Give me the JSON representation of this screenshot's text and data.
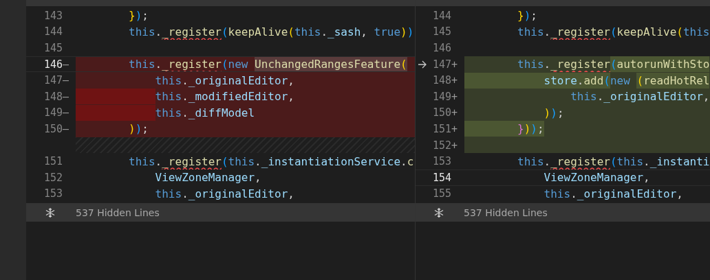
{
  "panes": [
    {
      "lines": [
        {
          "number": "143",
          "kind": "normal",
          "active": false,
          "revert_arrow": false,
          "indent_highlight": false,
          "tokens": [
            {
              "text": "        }",
              "kind": "b1",
              "highlight": false,
              "squiggle": false
            },
            {
              "text": ")",
              "kind": "b3",
              "highlight": false,
              "squiggle": false
            },
            {
              "text": ";",
              "kind": "p",
              "highlight": false,
              "squiggle": false
            }
          ]
        },
        {
          "number": "144",
          "kind": "normal",
          "active": false,
          "revert_arrow": false,
          "indent_highlight": false,
          "tokens": [
            {
              "text": "        this",
              "kind": "kw",
              "highlight": false,
              "squiggle": false
            },
            {
              "text": ".",
              "kind": "p",
              "highlight": false,
              "squiggle": false
            },
            {
              "text": "_register",
              "kind": "fn",
              "highlight": false,
              "squiggle": true
            },
            {
              "text": "(",
              "kind": "b3",
              "highlight": false,
              "squiggle": false
            },
            {
              "text": "keepAlive",
              "kind": "fn",
              "highlight": false,
              "squiggle": false
            },
            {
              "text": "(",
              "kind": "b1",
              "highlight": false,
              "squiggle": false
            },
            {
              "text": "this",
              "kind": "kw",
              "highlight": false,
              "squiggle": false
            },
            {
              "text": ".",
              "kind": "p",
              "highlight": false,
              "squiggle": false
            },
            {
              "text": "_sash",
              "kind": "var",
              "highlight": false,
              "squiggle": false
            },
            {
              "text": ", ",
              "kind": "p",
              "highlight": false,
              "squiggle": false
            },
            {
              "text": "true",
              "kind": "kw",
              "highlight": false,
              "squiggle": false
            },
            {
              "text": ")",
              "kind": "b1",
              "highlight": false,
              "squiggle": false
            },
            {
              "text": ")",
              "kind": "b3",
              "highlight": false,
              "squiggle": false
            }
          ]
        },
        {
          "number": "145",
          "kind": "normal",
          "active": false,
          "revert_arrow": false
        },
        {
          "number": "146",
          "sign": "—",
          "kind": "removed",
          "active": true,
          "revert_arrow": false,
          "indent_highlight": false,
          "tokens": [
            {
              "text": "        this",
              "kind": "kw",
              "highlight": false,
              "squiggle": false
            },
            {
              "text": ".",
              "kind": "p",
              "highlight": false,
              "squiggle": false
            },
            {
              "text": "_register",
              "kind": "fn",
              "highlight": false,
              "squiggle": true
            },
            {
              "text": "(",
              "kind": "b3",
              "highlight": false,
              "squiggle": false
            },
            {
              "text": "new ",
              "kind": "kw",
              "highlight": false,
              "squiggle": false
            },
            {
              "text": "UnchangedRangesFeature",
              "kind": "fn",
              "highlight": true,
              "squiggle": false
            },
            {
              "text": "(",
              "kind": "b1",
              "highlight": true,
              "squiggle": false
            }
          ]
        },
        {
          "number": "147",
          "sign": "—",
          "kind": "removed",
          "active": false,
          "revert_arrow": false,
          "indent_highlight": false,
          "tokens": [
            {
              "text": "            this",
              "kind": "kw",
              "highlight": false,
              "squiggle": false
            },
            {
              "text": ".",
              "kind": "p",
              "highlight": false,
              "squiggle": false
            },
            {
              "text": "_originalEditor",
              "kind": "var",
              "highlight": false,
              "squiggle": false
            },
            {
              "text": ",",
              "kind": "p",
              "highlight": false,
              "squiggle": false
            }
          ]
        },
        {
          "number": "148",
          "sign": "—",
          "kind": "removed",
          "active": false,
          "revert_arrow": false,
          "indent_highlight": true,
          "tokens": [
            {
              "text": "            this",
              "kind": "kw",
              "highlight": false,
              "squiggle": false
            },
            {
              "text": ".",
              "kind": "p",
              "highlight": false,
              "squiggle": false
            },
            {
              "text": "_modifiedEditor",
              "kind": "var",
              "highlight": false,
              "squiggle": false
            },
            {
              "text": ",",
              "kind": "p",
              "highlight": false,
              "squiggle": false
            }
          ]
        },
        {
          "number": "149",
          "sign": "—",
          "kind": "removed",
          "active": false,
          "revert_arrow": false,
          "indent_highlight": true,
          "tokens": [
            {
              "text": "            this",
              "kind": "kw",
              "highlight": false,
              "squiggle": false
            },
            {
              "text": ".",
              "kind": "p",
              "highlight": false,
              "squiggle": false
            },
            {
              "text": "_diffModel",
              "kind": "var",
              "highlight": false,
              "squiggle": false
            }
          ]
        },
        {
          "number": "150",
          "sign": "—",
          "kind": "removed",
          "active": false,
          "revert_arrow": false,
          "indent_highlight": false,
          "tokens": [
            {
              "text": "        )",
              "kind": "b1",
              "highlight": false,
              "squiggle": false
            },
            {
              "text": ")",
              "kind": "b3",
              "highlight": false,
              "squiggle": false
            },
            {
              "text": ";",
              "kind": "p",
              "highlight": false,
              "squiggle": false
            }
          ]
        },
        {
          "kind": "filler",
          "active": false,
          "revert_arrow": false
        },
        {
          "number": "151",
          "kind": "normal",
          "active": false,
          "revert_arrow": false,
          "indent_highlight": false,
          "tokens": [
            {
              "text": "        this",
              "kind": "kw",
              "highlight": false,
              "squiggle": false
            },
            {
              "text": ".",
              "kind": "p",
              "highlight": false,
              "squiggle": false
            },
            {
              "text": "_register",
              "kind": "fn",
              "highlight": false,
              "squiggle": true
            },
            {
              "text": "(",
              "kind": "b3",
              "highlight": false,
              "squiggle": false
            },
            {
              "text": "this",
              "kind": "kw",
              "highlight": false,
              "squiggle": false
            },
            {
              "text": ".",
              "kind": "p",
              "highlight": false,
              "squiggle": false
            },
            {
              "text": "_instantiationService",
              "kind": "var",
              "highlight": false,
              "squiggle": false
            },
            {
              "text": ".",
              "kind": "p",
              "highlight": false,
              "squiggle": false
            },
            {
              "text": "c",
              "kind": "fn",
              "highlight": false,
              "squiggle": false
            }
          ]
        },
        {
          "number": "152",
          "kind": "normal",
          "active": false,
          "revert_arrow": false,
          "indent_highlight": false,
          "tokens": [
            {
              "text": "            ViewZoneManager",
              "kind": "var",
              "highlight": false,
              "squiggle": false
            },
            {
              "text": ",",
              "kind": "p",
              "highlight": false,
              "squiggle": false
            }
          ]
        },
        {
          "number": "153",
          "kind": "normal",
          "active": false,
          "revert_arrow": false,
          "indent_highlight": false,
          "tokens": [
            {
              "text": "            this",
              "kind": "kw",
              "highlight": false,
              "squiggle": false
            },
            {
              "text": ".",
              "kind": "p",
              "highlight": false,
              "squiggle": false
            },
            {
              "text": "_originalEditor",
              "kind": "var",
              "highlight": false,
              "squiggle": false
            },
            {
              "text": ",",
              "kind": "p",
              "highlight": false,
              "squiggle": false
            }
          ]
        }
      ],
      "hidden_lines": "537 Hidden Lines"
    },
    {
      "lines": [
        {
          "number": "144",
          "kind": "normal",
          "active": false,
          "revert_arrow": false,
          "indent_highlight": false,
          "tokens": [
            {
              "text": "        }",
              "kind": "b1",
              "highlight": false,
              "squiggle": false
            },
            {
              "text": ")",
              "kind": "b3",
              "highlight": false,
              "squiggle": false
            },
            {
              "text": ";",
              "kind": "p",
              "highlight": false,
              "squiggle": false
            }
          ]
        },
        {
          "number": "145",
          "kind": "normal",
          "active": false,
          "revert_arrow": false,
          "indent_highlight": false,
          "tokens": [
            {
              "text": "        this",
              "kind": "kw",
              "highlight": false,
              "squiggle": false
            },
            {
              "text": ".",
              "kind": "p",
              "highlight": false,
              "squiggle": false
            },
            {
              "text": "_register",
              "kind": "fn",
              "highlight": false,
              "squiggle": true
            },
            {
              "text": "(",
              "kind": "b3",
              "highlight": false,
              "squiggle": false
            },
            {
              "text": "keepAlive",
              "kind": "fn",
              "highlight": false,
              "squiggle": false
            },
            {
              "text": "(",
              "kind": "b1",
              "highlight": false,
              "squiggle": false
            },
            {
              "text": "this",
              "kind": "kw",
              "highlight": false,
              "squiggle": false
            }
          ]
        },
        {
          "number": "146",
          "kind": "normal",
          "active": false,
          "revert_arrow": false
        },
        {
          "number": "147",
          "sign": "+",
          "kind": "added",
          "active": false,
          "revert_arrow": true,
          "indent_highlight": false,
          "tokens": [
            {
              "text": "        this",
              "kind": "kw",
              "highlight": false,
              "squiggle": false
            },
            {
              "text": ".",
              "kind": "p",
              "highlight": false,
              "squiggle": false
            },
            {
              "text": "_register",
              "kind": "fn",
              "highlight": false,
              "squiggle": true
            },
            {
              "text": "(",
              "kind": "b3",
              "highlight": true,
              "squiggle": false
            },
            {
              "text": "autorunWithSto",
              "kind": "fn",
              "highlight": true,
              "squiggle": false
            }
          ]
        },
        {
          "number": "148",
          "sign": "+",
          "kind": "added",
          "active": false,
          "revert_arrow": false,
          "indent_highlight": true,
          "tokens": [
            {
              "text": "            store",
              "kind": "var",
              "highlight": true,
              "squiggle": false
            },
            {
              "text": ".",
              "kind": "p",
              "highlight": true,
              "squiggle": false
            },
            {
              "text": "add",
              "kind": "fn",
              "highlight": true,
              "squiggle": false
            },
            {
              "text": "(",
              "kind": "b3",
              "highlight": true,
              "squiggle": false
            },
            {
              "text": "new ",
              "kind": "kw",
              "highlight": false,
              "squiggle": false
            },
            {
              "text": "(",
              "kind": "b1",
              "highlight": true,
              "squiggle": false
            },
            {
              "text": "readHotRel",
              "kind": "fn",
              "highlight": true,
              "squiggle": false
            }
          ]
        },
        {
          "number": "149",
          "sign": "+",
          "kind": "added",
          "active": false,
          "revert_arrow": false,
          "indent_highlight": false,
          "tokens": [
            {
              "text": "                this",
              "kind": "kw",
              "highlight": false,
              "squiggle": false
            },
            {
              "text": ".",
              "kind": "p",
              "highlight": false,
              "squiggle": false
            },
            {
              "text": "_originalEditor",
              "kind": "var",
              "highlight": false,
              "squiggle": false
            },
            {
              "text": ",",
              "kind": "p",
              "highlight": false,
              "squiggle": false
            }
          ]
        },
        {
          "number": "150",
          "sign": "+",
          "kind": "added",
          "active": false,
          "revert_arrow": false,
          "indent_highlight": false,
          "tokens": [
            {
              "text": "            )",
              "kind": "b1",
              "highlight": false,
              "squiggle": false
            },
            {
              "text": ")",
              "kind": "b3",
              "highlight": false,
              "squiggle": false
            },
            {
              "text": ";",
              "kind": "p",
              "highlight": false,
              "squiggle": false
            }
          ]
        },
        {
          "number": "151",
          "sign": "+",
          "kind": "added",
          "active": false,
          "revert_arrow": false,
          "indent_highlight": true,
          "tokens": [
            {
              "text": "        }",
              "kind": "b2",
              "highlight": true,
              "squiggle": false
            },
            {
              "text": ")",
              "kind": "b1",
              "highlight": true,
              "squiggle": false
            },
            {
              "text": ")",
              "kind": "b3",
              "highlight": true,
              "squiggle": false
            },
            {
              "text": ";",
              "kind": "p",
              "highlight": true,
              "squiggle": false
            }
          ]
        },
        {
          "number": "152",
          "sign": "+",
          "kind": "added",
          "active": false,
          "revert_arrow": false
        },
        {
          "number": "153",
          "kind": "normal",
          "active": false,
          "revert_arrow": false,
          "indent_highlight": false,
          "tokens": [
            {
              "text": "        this",
              "kind": "kw",
              "highlight": false,
              "squiggle": false
            },
            {
              "text": ".",
              "kind": "p",
              "highlight": false,
              "squiggle": false
            },
            {
              "text": "_register",
              "kind": "fn",
              "highlight": false,
              "squiggle": true
            },
            {
              "text": "(",
              "kind": "b3",
              "highlight": false,
              "squiggle": false
            },
            {
              "text": "this",
              "kind": "kw",
              "highlight": false,
              "squiggle": false
            },
            {
              "text": ".",
              "kind": "p",
              "highlight": false,
              "squiggle": false
            },
            {
              "text": "_instanti",
              "kind": "var",
              "highlight": false,
              "squiggle": false
            }
          ]
        },
        {
          "number": "154",
          "kind": "normal",
          "active": true,
          "revert_arrow": false,
          "indent_highlight": false,
          "tokens": [
            {
              "text": "            ViewZoneManager",
              "kind": "var",
              "highlight": false,
              "squiggle": false
            },
            {
              "text": ",",
              "kind": "p",
              "highlight": false,
              "squiggle": false
            }
          ]
        },
        {
          "number": "155",
          "kind": "normal",
          "active": false,
          "revert_arrow": false,
          "indent_highlight": false,
          "tokens": [
            {
              "text": "            this",
              "kind": "kw",
              "highlight": false,
              "squiggle": false
            },
            {
              "text": ".",
              "kind": "p",
              "highlight": false,
              "squiggle": false
            },
            {
              "text": "_originalEditor",
              "kind": "var",
              "highlight": false,
              "squiggle": false
            },
            {
              "text": ",",
              "kind": "p",
              "highlight": false,
              "squiggle": false
            }
          ]
        }
      ],
      "hidden_lines": "537 Hidden Lines"
    }
  ]
}
